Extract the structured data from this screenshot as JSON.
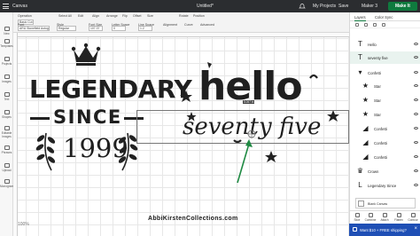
{
  "topbar": {
    "app_name": "Canvas",
    "doc_title": "Untitled*",
    "my_projects": "My Projects",
    "save": "Save",
    "machine": "Maker 3",
    "make": "Make It"
  },
  "editbar": {
    "groups": [
      {
        "label": "Operation",
        "value": "Basic Cut"
      },
      {
        "label": "Select All",
        "value": ""
      },
      {
        "label": "Edit",
        "value": ""
      },
      {
        "label": "Align",
        "value": ""
      },
      {
        "label": "Arrange",
        "value": ""
      },
      {
        "label": "Flip",
        "value": ""
      },
      {
        "label": "Offset",
        "value": ""
      },
      {
        "label": "Size",
        "value": ""
      },
      {
        "label": "Rotate",
        "value": ""
      },
      {
        "label": "Position",
        "value": ""
      }
    ],
    "font_label": "Font",
    "font_value": "ARU Stonefield Autograph",
    "style_label": "Style",
    "style_value": "Regular",
    "size_label": "Font Size",
    "size_value": "107.37",
    "letter_label": "Letter Space",
    "letter_value": "0",
    "line_label": "Line Space",
    "line_value": "1.2",
    "alignment_label": "Alignment",
    "curve_label": "Curve",
    "advanced_label": "Advanced"
  },
  "rail": [
    "New",
    "Templates",
    "Projects",
    "Images",
    "Text",
    "Shapes",
    "Editable Images",
    "Phrases",
    "Upload",
    "Monogram"
  ],
  "canvas": {
    "legendary": "LEGENDARY",
    "since": "SINCE",
    "year": "1999",
    "hello": "hello",
    "seventy_five": "seventy five",
    "footer": "AbbiKirstenCollections.com",
    "zoom": "100%",
    "size_tag": "5.057 in"
  },
  "panel": {
    "tab_layers": "Layers",
    "tab_color_sync": "Color Sync",
    "layers": [
      {
        "name": "Hello",
        "glyph": "T",
        "sub": false
      },
      {
        "name": "seventy five",
        "glyph": "T",
        "sub": false,
        "highlight": true
      },
      {
        "name": "Confetti",
        "glyph": "▾",
        "sub": false
      },
      {
        "name": "Star",
        "glyph": "★",
        "sub": true
      },
      {
        "name": "Star",
        "glyph": "★",
        "sub": true
      },
      {
        "name": "Star",
        "glyph": "★",
        "sub": true
      },
      {
        "name": "Confetti",
        "glyph": "◢",
        "sub": true
      },
      {
        "name": "Confetti",
        "glyph": "◢",
        "sub": true
      },
      {
        "name": "Confetti",
        "glyph": "◢",
        "sub": true
      },
      {
        "name": "Crown",
        "glyph": "♛",
        "sub": false
      },
      {
        "name": "Legendary Since",
        "glyph": "L",
        "sub": false
      }
    ],
    "blank_canvas": "Blank Canvas",
    "bottom_actions": [
      "Slice",
      "Combine",
      "Attach",
      "Flatten",
      "Contour"
    ],
    "promo": "Want $10 + FREE shipping?"
  }
}
